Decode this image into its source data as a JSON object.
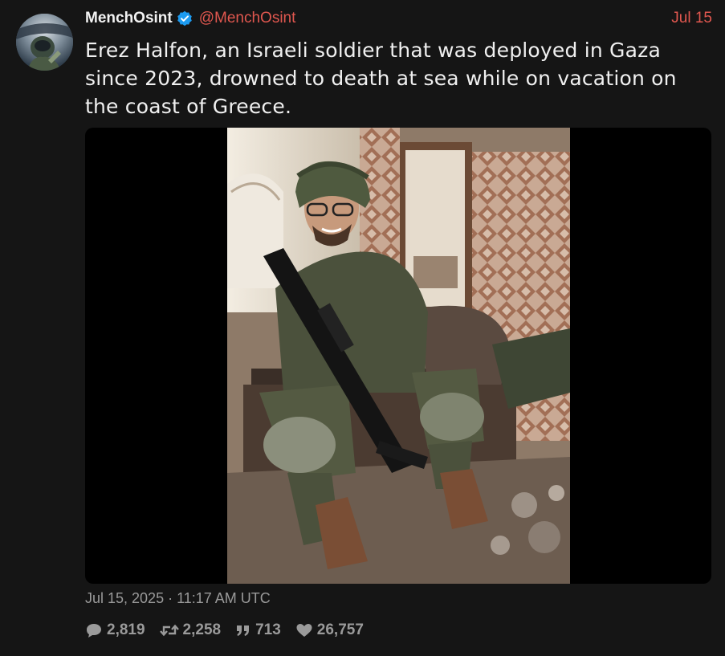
{
  "tweet": {
    "author": {
      "display_name": "MenchOsint",
      "handle": "@MenchOsint",
      "verified": true
    },
    "date": "Jul 15",
    "text": "Erez Halfon, an Israeli soldier that was deployed in Gaza since 2023, drowned to death at sea while on vacation on the coast of Greece.",
    "timestamp": "Jul 15, 2025 · 11:17 AM UTC",
    "stats": {
      "replies": "2,819",
      "retweets": "2,258",
      "quotes": "713",
      "likes": "26,757"
    }
  },
  "colors": {
    "background": "#151515",
    "accent_red": "#e0574f",
    "verified_blue": "#1d9bf0",
    "muted": "#9a9a9a"
  },
  "icons": {
    "reply": "speech-bubble-icon",
    "retweet": "retweet-arrows-icon",
    "quote": "quote-marks-icon",
    "like": "heart-icon"
  }
}
